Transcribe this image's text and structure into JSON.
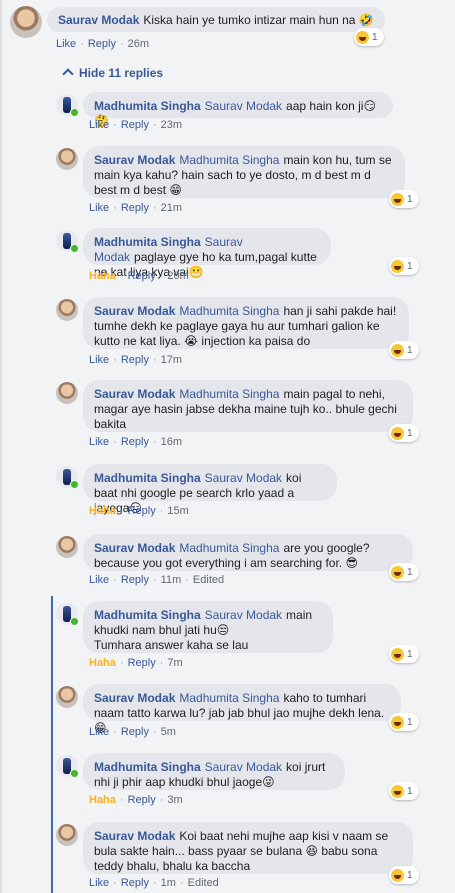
{
  "top_comment": {
    "author": "Saurav Modak",
    "text": "Kiska hain ye tumko intizar main hun na",
    "emoji": "🤣",
    "like": "Like",
    "reply": "Reply",
    "time": "26m",
    "reaction_count": "1"
  },
  "hide_replies_label": "Hide 11 replies",
  "replies": [
    {
      "author": "Madhumita Singha",
      "mention": "Saurav Modak",
      "text": "aap hain kon ji😏🤔",
      "reaction": "Like",
      "reply": "Reply",
      "time": "23m",
      "reaction_count": ""
    },
    {
      "author": "Saurav Modak",
      "mention": "Madhumita Singha",
      "text": "main kon hu, tum se main kya kahu? hain sach to ye dosto, m d best m d best m d best 😁",
      "reaction": "Like",
      "reply": "Reply",
      "time": "21m",
      "reaction_count": "1"
    },
    {
      "author": "Madhumita Singha",
      "mention": "Saurav Modak",
      "text": "paglaye gye ho ka tum,pagal kutte ne kat liya kya vai😬",
      "reaction": "Haha",
      "reply": "Reply",
      "time": "20m",
      "reaction_count": "1"
    },
    {
      "author": "Saurav Modak",
      "mention": "Madhumita Singha",
      "text": "han ji sahi pakde hai! tumhe dekh ke paglaye gaya hu aur tumhari galion ke kutto ne kat liya. 😭 injection ka paisa do",
      "reaction": "Like",
      "reply": "Reply",
      "time": "17m",
      "reaction_count": "1"
    },
    {
      "author": "Saurav Modak",
      "mention": "Madhumita Singha",
      "text": "main pagal to nehi, magar aye hasin jabse dekha maine tujh ko.. bhule gechi bakita",
      "reaction": "Like",
      "reply": "Reply",
      "time": "16m",
      "reaction_count": "1"
    },
    {
      "author": "Madhumita Singha",
      "mention": "Saurav Modak",
      "text": "koi baat nhi google pe search krlo yaad a jayega😑",
      "reaction": "Haha",
      "reply": "Reply",
      "time": "15m",
      "reaction_count": ""
    },
    {
      "author": "Saurav Modak",
      "mention": "Madhumita Singha",
      "text": "are you google? because you got everything i am searching for. 😎",
      "reaction": "Like",
      "reply": "Reply",
      "time": "11m",
      "edited": "Edited",
      "reaction_count": "1"
    },
    {
      "author": "Madhumita Singha",
      "mention": "Saurav Modak",
      "text": "main khudki nam bhul jati hu😒",
      "text2": "Tumhara answer kaha se lau",
      "reaction": "Haha",
      "reply": "Reply",
      "time": "7m",
      "reaction_count": "1"
    },
    {
      "author": "Saurav Modak",
      "mention": "Madhumita Singha",
      "text": "kaho to tumhari naam tatto karwa lu? jab jab bhul jao mujhe dekh lena. 😁",
      "reaction": "Like",
      "reply": "Reply",
      "time": "5m",
      "reaction_count": "1"
    },
    {
      "author": "Madhumita Singha",
      "mention": "Saurav Modak",
      "text": "koi jrurt nhi ji phir aap khudki bhul jaoge😜",
      "reaction": "Haha",
      "reply": "Reply",
      "time": "3m",
      "reaction_count": "1"
    },
    {
      "author": "Saurav Modak",
      "mention": "",
      "text": "Koi baat nehi mujhe aap kisi v naam se bula sakte hain... bass pyaar se bulana 😆 babu sona teddy bhalu, bhalu ka baccha",
      "reaction": "Like",
      "reply": "Reply",
      "time": "1m",
      "edited": "Edited",
      "reaction_count": "1"
    }
  ],
  "colors": {
    "link": "#385898",
    "haha": "#f7b125",
    "bubble": "#e4e6eb",
    "thread": "#4267b2"
  }
}
